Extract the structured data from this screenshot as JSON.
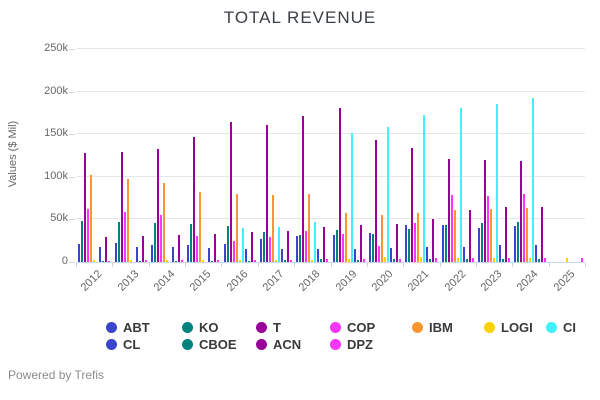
{
  "title": "TOTAL REVENUE",
  "footer": {
    "text": "Powered by Trefis"
  },
  "y_axis": {
    "label": "Values ($ Mil)",
    "ticks": [
      "0",
      "50k",
      "100k",
      "150k",
      "200k",
      "250k"
    ]
  },
  "chart_data": {
    "type": "bar",
    "title": "TOTAL REVENUE",
    "xlabel": "",
    "ylabel": "Values ($ Mil)",
    "value_unit": "thousands of $ Mil (k)",
    "ylim_k": [
      0,
      250
    ],
    "grid": true,
    "legend_position": "bottom",
    "categories": [
      "2012",
      "2013",
      "2014",
      "2015",
      "2016",
      "2017",
      "2018",
      "2019",
      "2020",
      "2021",
      "2022",
      "2023",
      "2024",
      "2025"
    ],
    "legend_rows": [
      [
        "ABT",
        "KO",
        "T",
        "COP",
        "IBM",
        "LOGI",
        "CI"
      ],
      [
        "CL",
        "CBOE",
        "ACN",
        "DPZ"
      ]
    ],
    "series": [
      {
        "name": "ABT",
        "color": "#3a46c9",
        "values": [
          21.5,
          21.8,
          20.2,
          20.4,
          20.9,
          27.4,
          30.6,
          31.9,
          34.6,
          43.1,
          43.7,
          40.1,
          42.0,
          0
        ]
      },
      {
        "name": "KO",
        "color": "#00837e",
        "values": [
          48.0,
          46.9,
          46.0,
          44.3,
          41.9,
          35.4,
          31.9,
          37.3,
          33.0,
          38.7,
          43.0,
          45.8,
          47.1,
          0
        ]
      },
      {
        "name": "T",
        "color": "#990099",
        "values": [
          127.4,
          128.8,
          132.4,
          146.8,
          163.8,
          160.5,
          170.8,
          181.2,
          143.0,
          134.0,
          120.7,
          120.2,
          119.0,
          0
        ]
      },
      {
        "name": "COP",
        "color": "#fc35fc",
        "values": [
          62.0,
          58.2,
          55.5,
          30.9,
          24.4,
          29.1,
          36.4,
          32.6,
          18.8,
          45.8,
          78.5,
          78.0,
          80.0,
          0
        ]
      },
      {
        "name": "IBM",
        "color": "#fa9632",
        "values": [
          102.0,
          98.0,
          92.8,
          81.7,
          79.9,
          79.1,
          79.6,
          57.7,
          55.2,
          57.4,
          60.5,
          61.9,
          62.8,
          0
        ]
      },
      {
        "name": "LOGI",
        "color": "#fcd202",
        "values": [
          2.3,
          2.1,
          2.1,
          2.1,
          2.2,
          2.5,
          2.8,
          3.0,
          5.3,
          5.5,
          4.5,
          4.3,
          4.4,
          4.6
        ]
      },
      {
        "name": "CI",
        "color": "#3ef1fb",
        "values": [
          0,
          0,
          0,
          0,
          39.7,
          41.6,
          47.0,
          151.0,
          158.0,
          172.0,
          180.5,
          186.0,
          193.0,
          0
        ]
      },
      {
        "name": "CL",
        "color": "#3a46c9",
        "values": [
          17.1,
          17.4,
          17.3,
          16.0,
          15.2,
          15.5,
          15.5,
          15.7,
          16.5,
          17.4,
          18.0,
          19.5,
          20.1,
          0
        ]
      },
      {
        "name": "CBOE",
        "color": "#00837e",
        "values": [
          0.5,
          0.6,
          0.6,
          0.6,
          0.7,
          2.2,
          3.1,
          2.5,
          3.4,
          3.5,
          4.0,
          3.8,
          4.1,
          0
        ]
      },
      {
        "name": "ACN",
        "color": "#990099",
        "values": [
          29.8,
          30.4,
          31.9,
          32.9,
          34.8,
          36.8,
          41.6,
          43.2,
          44.3,
          50.5,
          61.6,
          64.1,
          64.9,
          0
        ]
      },
      {
        "name": "DPZ",
        "color": "#fc35fc",
        "values": [
          1.7,
          1.8,
          2.0,
          2.2,
          2.5,
          2.8,
          3.4,
          3.6,
          4.1,
          4.4,
          4.5,
          4.5,
          4.7,
          4.5
        ]
      }
    ]
  }
}
